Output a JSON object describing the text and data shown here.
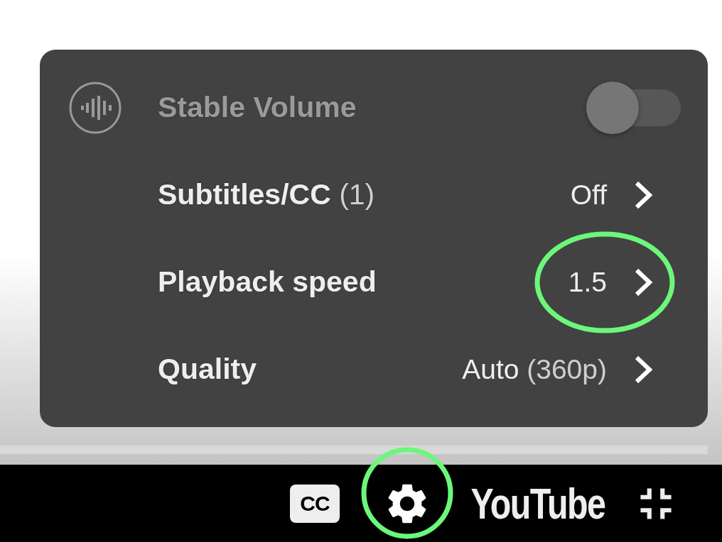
{
  "menu": {
    "items": [
      {
        "kind": "toggle",
        "label": "Stable Volume",
        "on": false,
        "disabled": true
      },
      {
        "kind": "submenu",
        "label": "Subtitles/CC",
        "label_note": "(1)",
        "value": "Off",
        "highlighted": false
      },
      {
        "kind": "submenu",
        "label": "Playback speed",
        "value": "1.5",
        "highlighted": true
      },
      {
        "kind": "submenu",
        "label": "Quality",
        "value": "Auto",
        "value_note": "(360p)",
        "highlighted": false
      }
    ]
  },
  "controls": [
    {
      "kind": "captions",
      "label": "CC"
    },
    {
      "kind": "settings",
      "highlighted": true
    },
    {
      "kind": "logo",
      "label": "YouTube"
    },
    {
      "kind": "exit-fullscreen"
    }
  ]
}
